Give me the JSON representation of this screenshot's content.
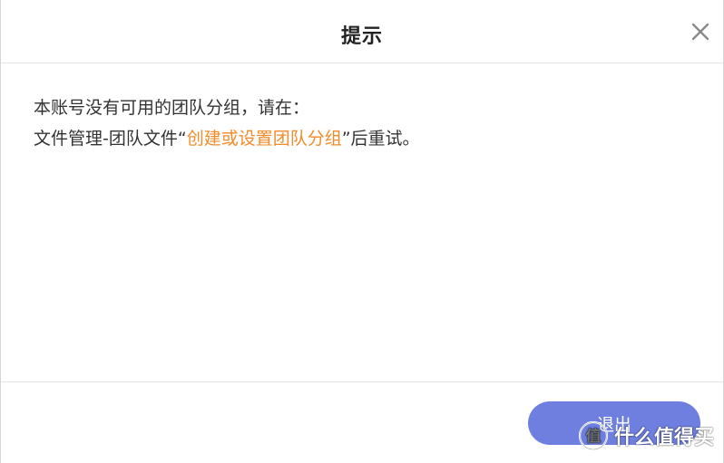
{
  "dialog": {
    "title": "提示",
    "message": {
      "line1": "本账号没有可用的团队分组，请在：",
      "line2_prefix": "文件管理-团队文件“",
      "line2_link": "创建或设置团队分组",
      "line2_suffix": "”后重试。"
    },
    "exit_label": "退出"
  },
  "watermark": {
    "text": "什么值得买"
  },
  "colors": {
    "link": "#f08c2a",
    "button": "#6e7fe0",
    "title_text": "#222222",
    "body_text": "#333333",
    "divider": "#e3e3e3"
  },
  "icons": {
    "close": "close-icon",
    "watermark_logo": "smzdm-logo-icon"
  }
}
